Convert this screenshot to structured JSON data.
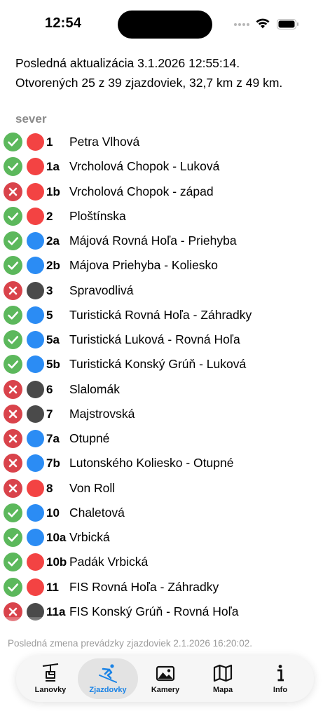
{
  "status": {
    "time": "12:54"
  },
  "header": {
    "line1": "Posledná aktualizácia 3.1.2026 12:55:14.",
    "line2": "Otvorených 25 z 39 zjazdoviek, 32,7 km z 49 km."
  },
  "section": {
    "title": "sever"
  },
  "colors": {
    "open": "#5cb85c",
    "closed": "#d9434b",
    "red": "#f34343",
    "blue": "#2b8cf4",
    "black": "#4a4a4a",
    "accent": "#1a83e6"
  },
  "runs": [
    {
      "status": "open",
      "difficulty": "red",
      "number": "1",
      "name": "Petra Vlhová"
    },
    {
      "status": "open",
      "difficulty": "red",
      "number": "1a",
      "name": "Vrcholová Chopok - Luková"
    },
    {
      "status": "closed",
      "difficulty": "red",
      "number": "1b",
      "name": "Vrcholová Chopok - západ"
    },
    {
      "status": "open",
      "difficulty": "red",
      "number": "2",
      "name": "Ploštínska"
    },
    {
      "status": "open",
      "difficulty": "blue",
      "number": "2a",
      "name": "Májová Rovná Hoľa - Priehyba"
    },
    {
      "status": "open",
      "difficulty": "blue",
      "number": "2b",
      "name": "Májova Priehyba - Koliesko"
    },
    {
      "status": "closed",
      "difficulty": "black",
      "number": "3",
      "name": "Spravodlivá"
    },
    {
      "status": "open",
      "difficulty": "blue",
      "number": "5",
      "name": "Turistická Rovná Hoľa - Záhradky"
    },
    {
      "status": "open",
      "difficulty": "blue",
      "number": "5a",
      "name": "Turistická Luková - Rovná Hoľa"
    },
    {
      "status": "open",
      "difficulty": "blue",
      "number": "5b",
      "name": "Turistická Konský Grúň - Luková"
    },
    {
      "status": "closed",
      "difficulty": "black",
      "number": "6",
      "name": "Slalomák"
    },
    {
      "status": "closed",
      "difficulty": "black",
      "number": "7",
      "name": "Majstrovská"
    },
    {
      "status": "closed",
      "difficulty": "blue",
      "number": "7a",
      "name": "Otupné"
    },
    {
      "status": "closed",
      "difficulty": "blue",
      "number": "7b",
      "name": "Lutonského Koliesko - Otupné"
    },
    {
      "status": "closed",
      "difficulty": "red",
      "number": "8",
      "name": "Von Roll"
    },
    {
      "status": "open",
      "difficulty": "blue",
      "number": "10",
      "name": "Chaletová"
    },
    {
      "status": "open",
      "difficulty": "blue",
      "number": "10a",
      "name": "Vrbická"
    },
    {
      "status": "open",
      "difficulty": "red",
      "number": "10b",
      "name": "Padák Vrbická"
    },
    {
      "status": "open",
      "difficulty": "red",
      "number": "11",
      "name": "FIS Rovná Hoľa - Záhradky"
    },
    {
      "status": "closed",
      "difficulty": "black",
      "number": "11a",
      "name": "FIS Konský Grúň - Rovná Hoľa"
    }
  ],
  "footer": {
    "text": "Posledná zmena prevádzky zjazdoviek 2.1.2026 16:20:02."
  },
  "tabs": [
    {
      "label": "Lanovky",
      "icon": "chairlift-icon",
      "active": false
    },
    {
      "label": "Zjazdovky",
      "icon": "skier-icon",
      "active": true
    },
    {
      "label": "Kamery",
      "icon": "photo-icon",
      "active": false
    },
    {
      "label": "Mapa",
      "icon": "map-icon",
      "active": false
    },
    {
      "label": "Info",
      "icon": "info-icon",
      "active": false
    }
  ]
}
